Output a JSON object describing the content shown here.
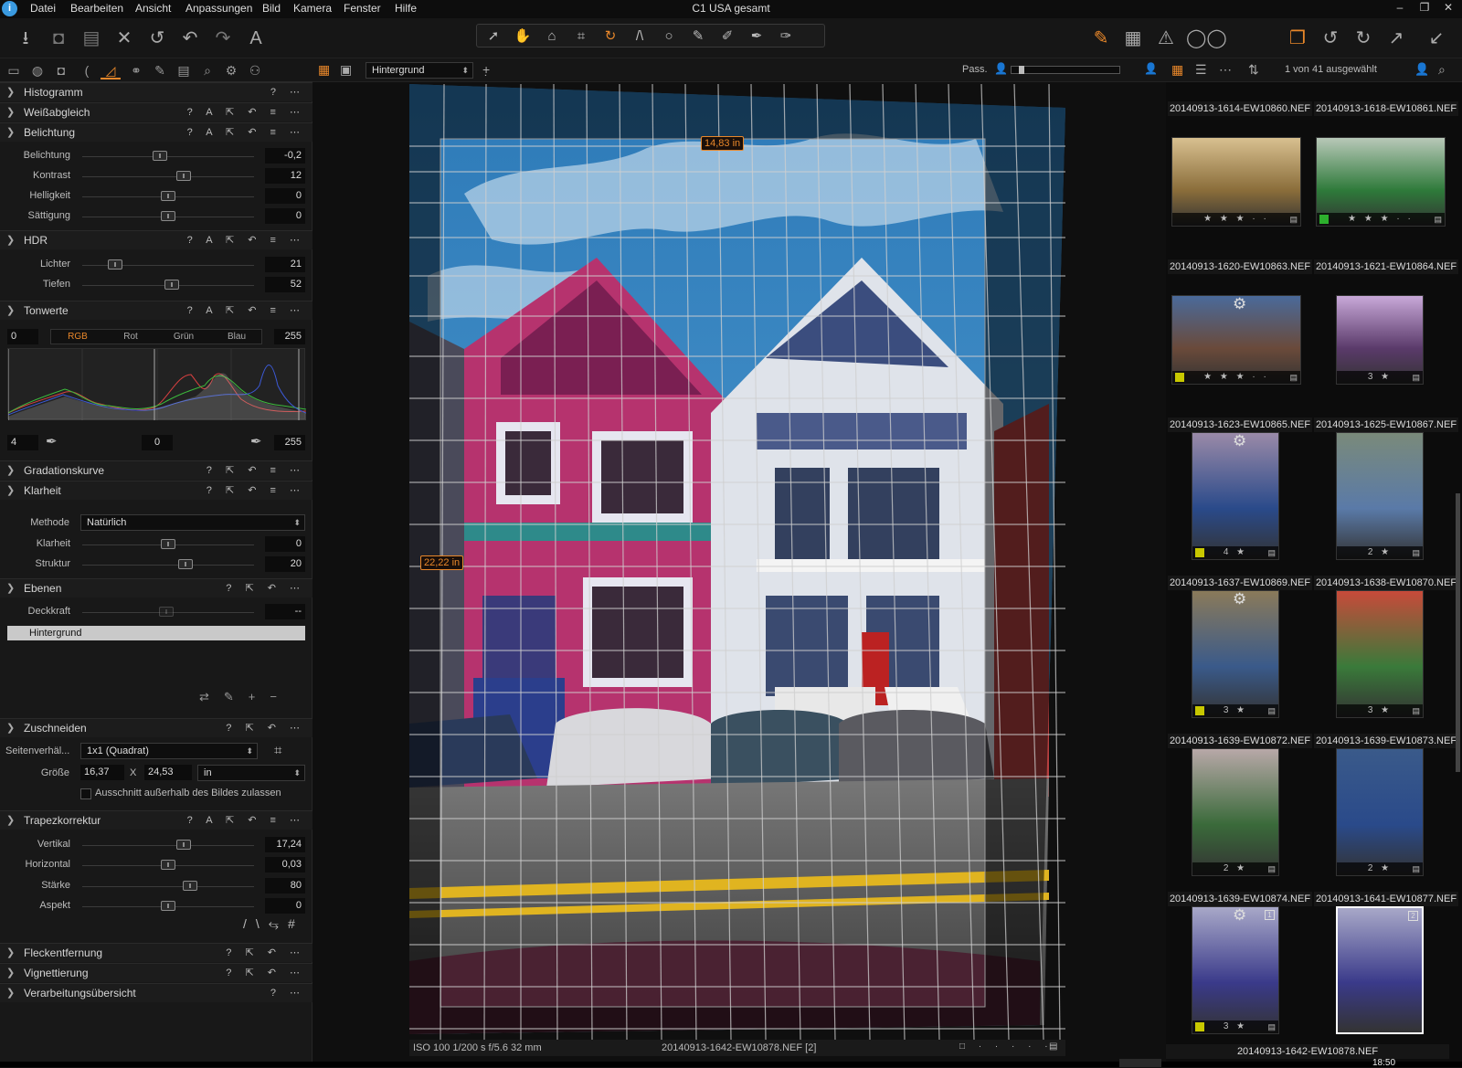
{
  "app": {
    "title": "C1 USA gesamt"
  },
  "menu": [
    "Datei",
    "Bearbeiten",
    "Ansicht",
    "Anpassungen",
    "Bild",
    "Kamera",
    "Fenster",
    "Hilfe"
  ],
  "viewer_toolbar": {
    "layer_select": "Hintergrund",
    "proof_label": "Pass."
  },
  "browser_toolbar": {
    "selection_count": "1 von 41 ausgewählt"
  },
  "tools": {
    "histogram": {
      "name": "Histogramm"
    },
    "white_balance": {
      "name": "Weißabgleich"
    },
    "exposure": {
      "name": "Belichtung",
      "rows": [
        {
          "label": "Belichtung",
          "value": "-0,2",
          "pos": 0.45
        },
        {
          "label": "Kontrast",
          "value": "12",
          "pos": 0.59
        },
        {
          "label": "Helligkeit",
          "value": "0",
          "pos": 0.5
        },
        {
          "label": "Sättigung",
          "value": "0",
          "pos": 0.5
        }
      ]
    },
    "hdr": {
      "name": "HDR",
      "rows": [
        {
          "label": "Lichter",
          "value": "21",
          "pos": 0.19
        },
        {
          "label": "Tiefen",
          "value": "52",
          "pos": 0.52
        }
      ]
    },
    "levels": {
      "name": "Tonwerte",
      "channels": [
        "RGB",
        "Rot",
        "Grün",
        "Blau"
      ],
      "active_channel": "RGB",
      "out_low": "0",
      "out_high": "255",
      "in_low": "4",
      "mid": "0",
      "in_high": "255"
    },
    "curve": {
      "name": "Gradationskurve"
    },
    "clarity": {
      "name": "Klarheit",
      "method_label": "Methode",
      "method_value": "Natürlich",
      "rows": [
        {
          "label": "Klarheit",
          "value": "0",
          "pos": 0.5
        },
        {
          "label": "Struktur",
          "value": "20",
          "pos": 0.6
        }
      ]
    },
    "layers": {
      "name": "Ebenen",
      "opacity_label": "Deckkraft",
      "opacity_value": "--",
      "layer": "Hintergrund"
    },
    "crop": {
      "name": "Zuschneiden",
      "ratio_label": "Seitenverhäl...",
      "ratio_value": "1x1 (Quadrat)",
      "size_label": "Größe",
      "w": "16,37",
      "x": "X",
      "h": "24,53",
      "unit": "in",
      "checkbox_label": "Ausschnitt außerhalb des Bildes zulassen",
      "checkbox_checked": false
    },
    "keystone": {
      "name": "Trapezkorrektur",
      "rows": [
        {
          "label": "Vertikal",
          "value": "17,24",
          "pos": 0.59
        },
        {
          "label": "Horizontal",
          "value": "0,03",
          "pos": 0.5
        },
        {
          "label": "Stärke",
          "value": "80",
          "pos": 0.63
        },
        {
          "label": "Aspekt",
          "value": "0",
          "pos": 0.5
        }
      ]
    },
    "spot": {
      "name": "Fleckentfernung"
    },
    "vignette": {
      "name": "Vignettierung"
    },
    "summary": {
      "name": "Verarbeitungsübersicht"
    }
  },
  "viewer": {
    "measure_top": "14,83 in",
    "measure_left": "22,22 in",
    "info": "ISO 100  1/200 s  f/5.6  32 mm",
    "filename": "20140913-1642-EW10878.NEF [2]"
  },
  "browser": {
    "rows": [
      {
        "left": {
          "name": "20140913-1614-EW10860.NEF"
        },
        "right": {
          "name": "20140913-1618-EW10861.NEF"
        }
      },
      {
        "left": {
          "name": "20140913-1620-EW10863.NEF",
          "stars": 3,
          "color": "",
          "rating_text": "★ ★ ★ · ·"
        },
        "right": {
          "name": "20140913-1621-EW10864.NEF",
          "stars": 3,
          "color": "#2db02d",
          "rating_text": "★ ★ ★ · ·"
        }
      },
      {
        "left": {
          "name": "20140913-1623-EW10865.NEF",
          "stars": 3,
          "color": "#c8c800",
          "rating_text": "★ ★ ★ · ·"
        },
        "right": {
          "name": "20140913-1625-EW10867.NEF",
          "stars": 3,
          "rating_text": "3 ★"
        }
      },
      {
        "left": {
          "name": "20140913-1637-EW10869.NEF",
          "stars": 4,
          "color": "#c8c800",
          "rating_text": "4 ★"
        },
        "right": {
          "name": "20140913-1638-EW10870.NEF",
          "stars": 2,
          "rating_text": "2 ★"
        }
      },
      {
        "left": {
          "name": "20140913-1639-EW10872.NEF",
          "stars": 3,
          "color": "#c8c800",
          "rating_text": "3 ★"
        },
        "right": {
          "name": "20140913-1639-EW10873.NEF",
          "stars": 3,
          "rating_text": "3 ★"
        }
      },
      {
        "left": {
          "name": "20140913-1639-EW10874.NEF",
          "stars": 2,
          "rating_text": "2 ★"
        },
        "right": {
          "name": "20140913-1641-EW10877.NEF",
          "stars": 2,
          "rating_text": "2 ★"
        }
      },
      {
        "left": {
          "name": "",
          "stars": 3,
          "color": "#c8c800",
          "rating_text": "3 ★",
          "badge": "1"
        },
        "right": {
          "name": "20140913-1642-EW10878.NEF",
          "selected": true,
          "badge": "2"
        }
      }
    ]
  },
  "status": {
    "clock": "18:50"
  }
}
